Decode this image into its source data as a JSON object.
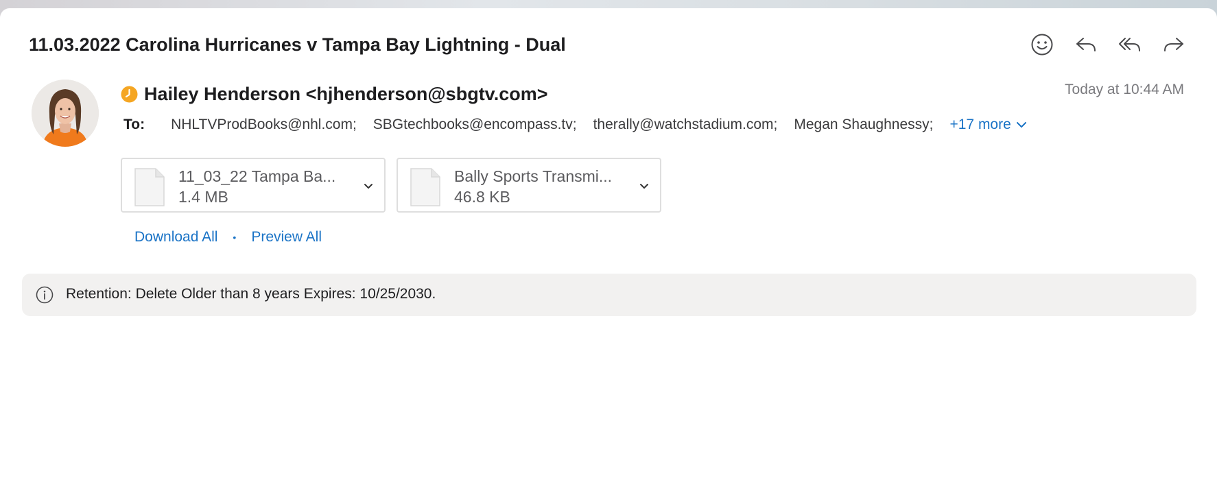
{
  "message": {
    "subject": "11.03.2022 Carolina Hurricanes v Tampa Bay Lightning - Dual",
    "sender": "Hailey Henderson <hjhenderson@sbgtv.com>",
    "date": "Today at 10:44 AM",
    "to_label": "To:",
    "recipients": [
      "NHLTVProdBooks@nhl.com;",
      "SBGtechbooks@encompass.tv;",
      "therally@watchstadium.com;",
      "Megan Shaughnessy;"
    ],
    "more_recipients": "+17 more"
  },
  "toolbar": {
    "icons": [
      "smiley-icon",
      "reply-icon",
      "reply-all-icon",
      "forward-icon"
    ]
  },
  "attachments": [
    {
      "name": "11_03_22 Tampa Ba...",
      "size": "1.4 MB"
    },
    {
      "name": "Bally Sports Transmi...",
      "size": "46.8 KB"
    }
  ],
  "links": {
    "download_all": "Download All",
    "separator": "•",
    "preview_all": "Preview All"
  },
  "retention": {
    "text": "Retention: Delete Older than 8 years Expires: 10/25/2030."
  },
  "colors": {
    "accent": "#1a73c6",
    "clock_badge": "#f5a623",
    "retention_bg": "#f2f1f0"
  }
}
